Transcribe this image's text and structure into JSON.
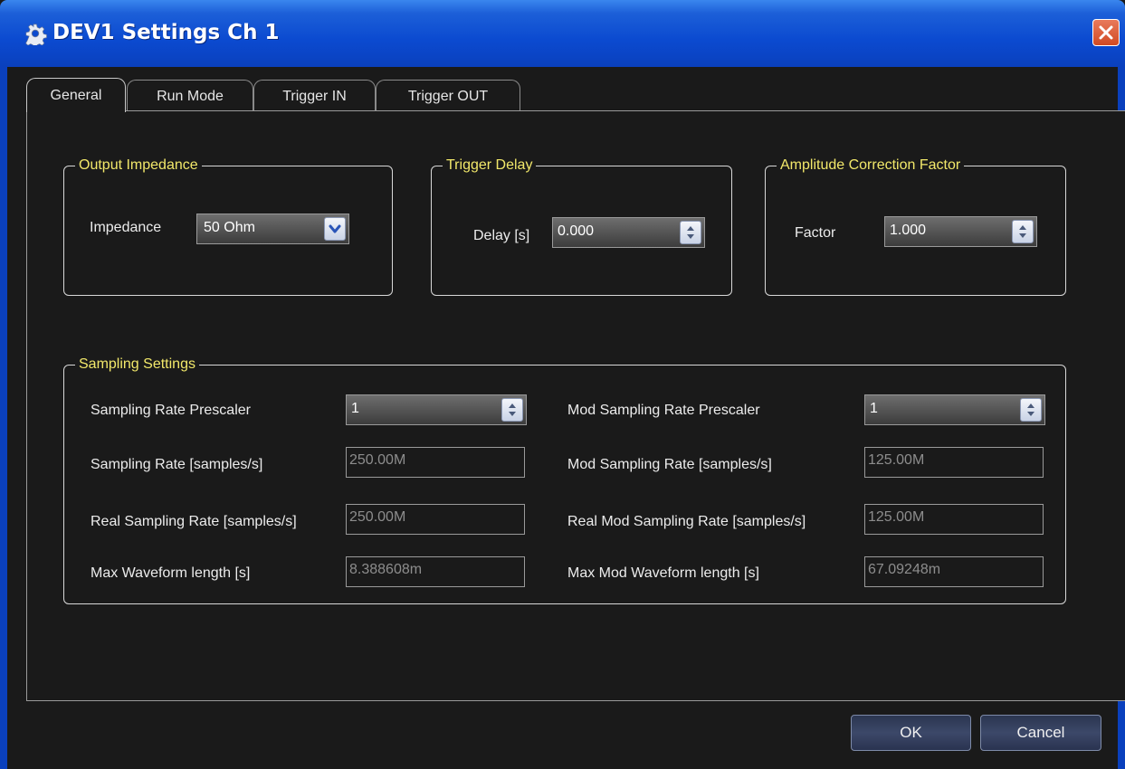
{
  "window": {
    "title": "DEV1 Settings Ch 1"
  },
  "tabs": [
    {
      "label": "General",
      "active": true
    },
    {
      "label": "Run Mode",
      "active": false
    },
    {
      "label": "Trigger IN",
      "active": false
    },
    {
      "label": "Trigger OUT",
      "active": false
    }
  ],
  "output_impedance": {
    "legend": "Output Impedance",
    "label": "Impedance",
    "value": "50 Ohm"
  },
  "trigger_delay": {
    "legend": "Trigger Delay",
    "label": "Delay [s]",
    "value": "0.000"
  },
  "amplitude_correction": {
    "legend": "Amplitude Correction Factor",
    "label": "Factor",
    "value": "1.000"
  },
  "sampling": {
    "legend": "Sampling Settings",
    "prescaler": {
      "label": "Sampling Rate Prescaler",
      "value": "1"
    },
    "rate": {
      "label": "Sampling Rate [samples/s]",
      "value": "250.00M"
    },
    "real_rate": {
      "label": "Real Sampling Rate [samples/s]",
      "value": "250.00M"
    },
    "max_len": {
      "label": "Max Waveform length [s]",
      "value": "8.388608m"
    },
    "mod_prescaler": {
      "label": "Mod Sampling Rate Prescaler",
      "value": "1"
    },
    "mod_rate": {
      "label": "Mod Sampling Rate [samples/s]",
      "value": "125.00M"
    },
    "real_mod_rate": {
      "label": "Real Mod Sampling Rate [samples/s]",
      "value": "125.00M"
    },
    "mod_max_len": {
      "label": "Max Mod Waveform length [s]",
      "value": "67.09248m"
    }
  },
  "buttons": {
    "ok": "OK",
    "cancel": "Cancel"
  },
  "colors": {
    "titlebar": "#0b4ad0",
    "legend_text": "#f2e86a",
    "background": "#1a1a1a",
    "close_button": "#d14a22"
  },
  "icons": {
    "window_icon": "gear-icon",
    "close": "close-icon",
    "spin_arrows": "spin-arrows-icon",
    "dropdown": "chevron-down-icon"
  }
}
